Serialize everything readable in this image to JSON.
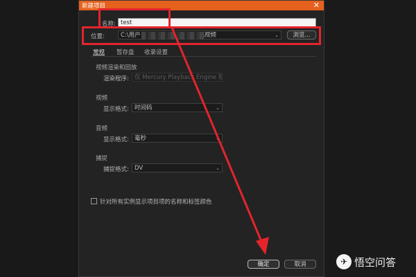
{
  "dialog": {
    "title": "新建项目",
    "close_glyph": "✕"
  },
  "name_field": {
    "label": "名称:",
    "value": "test"
  },
  "location": {
    "label": "位置:",
    "path_start": "C:\\用户",
    "path_end": "\\视频",
    "browse_label": "浏览..."
  },
  "tabs": [
    {
      "label": "常规"
    },
    {
      "label": "暂存盘"
    },
    {
      "label": "收录设置"
    }
  ],
  "video_rendering": {
    "section": "视频渲染和回放",
    "renderer_label": "渲染程序:",
    "renderer_value": "仅 Mercury Playback Engine 软件"
  },
  "video": {
    "section": "视频",
    "format_label": "显示格式:",
    "format_value": "时间码"
  },
  "audio": {
    "section": "音频",
    "format_label": "显示格式:",
    "format_value": "毫秒"
  },
  "capture": {
    "section": "捕捉",
    "format_label": "捕捉格式:",
    "format_value": "DV"
  },
  "checkbox_label": "针对所有实例显示项目项的名称和标签颜色",
  "buttons": {
    "ok": "确定",
    "cancel": "取消"
  },
  "watermark": {
    "text": "悟空问答"
  },
  "colors": {
    "titlebar": "#e5611d",
    "highlight": "#e4242c"
  }
}
